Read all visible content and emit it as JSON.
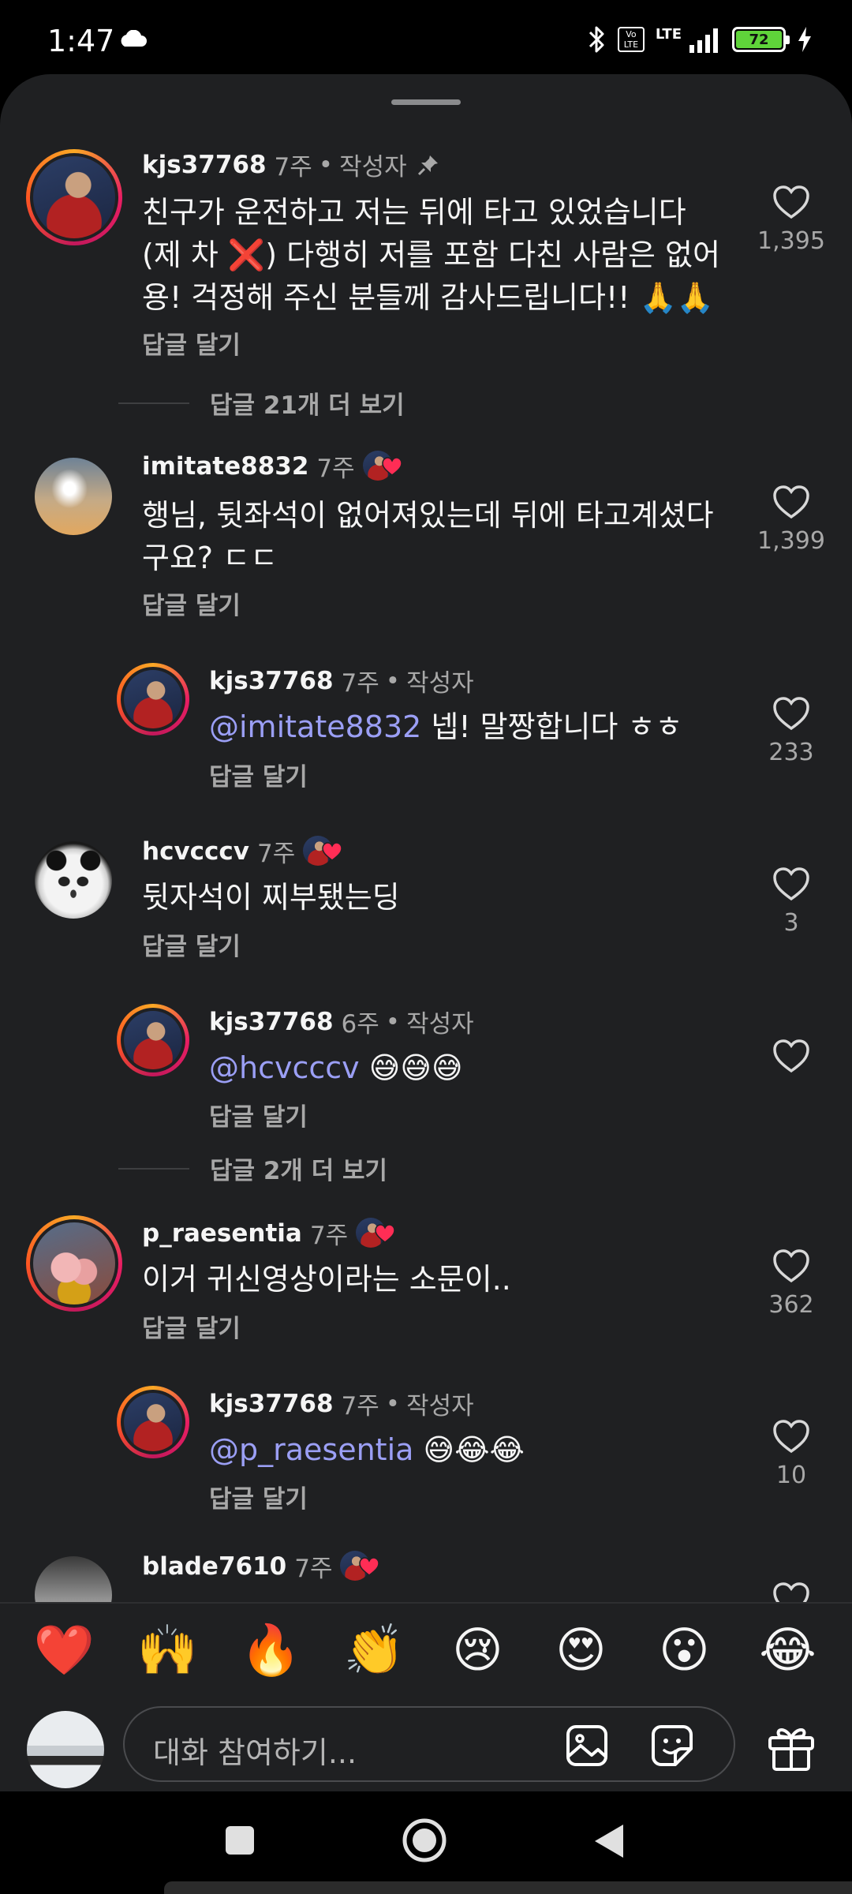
{
  "status": {
    "time": "1:47",
    "volte": "Vo LTE",
    "network": "LTE",
    "battery": "72"
  },
  "comments": [
    {
      "username": "kjs37768",
      "time": "7주",
      "author_label": "작성자",
      "text": "친구가 운전하고 저는 뒤에 타고 있었습니다 (제 차 ❌) 다행히 저를 포함 다친 사람은 없어용! 걱정해 주신 분들께 감사드립니다!! 🙏🙏",
      "reply_label": "답글 달기",
      "likes": "1,395",
      "more_replies": "답글 21개 더 보기"
    },
    {
      "username": "imitate8832",
      "time": "7주",
      "text": "행님, 뒷좌석이 없어져있는데 뒤에 타고계셨다구요? ㄷㄷ",
      "reply_label": "답글 달기",
      "likes": "1,399"
    },
    {
      "username": "kjs37768",
      "time": "7주",
      "author_label": "작성자",
      "mention": "@imitate8832",
      "text": " 넵! 말짱합니다 ㅎㅎ",
      "reply_label": "답글 달기",
      "likes": "233"
    },
    {
      "username": "hcvcccv",
      "time": "7주",
      "text": "뒷자석이 찌부됐는딩",
      "reply_label": "답글 달기",
      "likes": "3"
    },
    {
      "username": "kjs37768",
      "time": "6주",
      "author_label": "작성자",
      "mention": "@hcvcccv",
      "text": " 😅😅😅",
      "reply_label": "답글 달기",
      "likes": "",
      "more_replies": "답글 2개 더 보기"
    },
    {
      "username": "p_raesentia",
      "time": "7주",
      "text": "이거 귀신영상이라는 소문이..",
      "reply_label": "답글 달기",
      "likes": "362"
    },
    {
      "username": "kjs37768",
      "time": "7주",
      "author_label": "작성자",
      "mention": "@p_raesentia",
      "text": " 😅😂😂",
      "reply_label": "답글 달기",
      "likes": "10"
    },
    {
      "username": "blade7610",
      "time": "7주"
    }
  ],
  "dot": "•",
  "emojis": [
    "❤️",
    "🙌",
    "🔥",
    "👏",
    "😢",
    "😍",
    "😮",
    "😂"
  ],
  "input": {
    "placeholder": "대화 참여하기..."
  },
  "icons": {
    "pin": "pin-icon",
    "heart": "heart-outline-icon",
    "image": "image-icon",
    "sticker": "sticker-icon",
    "gift": "gift-icon"
  },
  "colors": {
    "background": "#1f2022",
    "mention": "#9b9ff5",
    "secondary_text": "#a8a8a8",
    "heart_badge": "#ff2d55"
  }
}
